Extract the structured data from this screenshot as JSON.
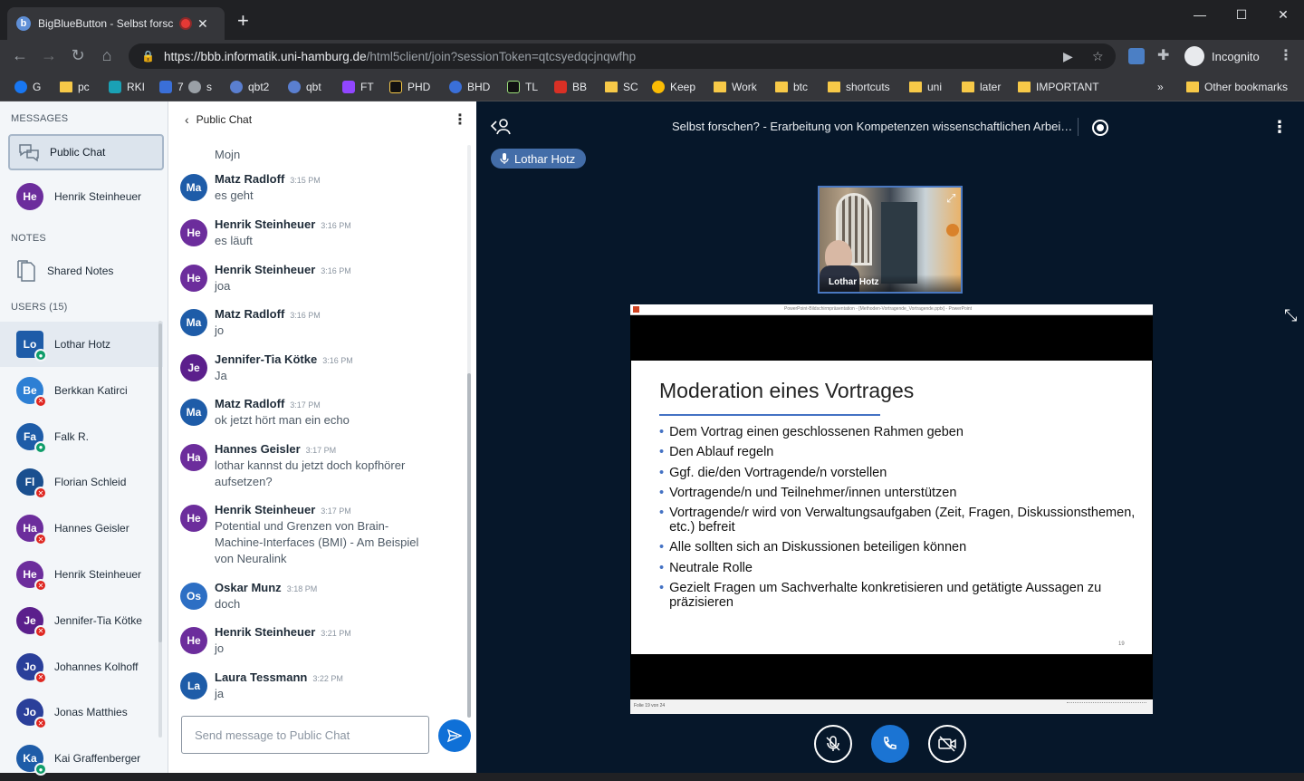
{
  "browser": {
    "tab_title": "BigBlueButton - Selbst forschen? - Erarbeitung von Kompetenzen",
    "tab_favicon": "b",
    "url_host": "https://bbb.informatik.uni-hamburg.de",
    "url_path": "/html5client/join?sessionToken=qtcsyedqcjnqwfhp",
    "profile_label": "Incognito",
    "bookmarks": [
      "G",
      "pc",
      "RKI",
      "7",
      "s",
      "qbt2",
      "qbt",
      "FT",
      "PHD",
      "BHD",
      "TL",
      "BB",
      "SC",
      "Keep",
      "Work",
      "btc",
      "shortcuts",
      "uni",
      "later",
      "IMPORTANT"
    ],
    "other_bookmarks": "Other bookmarks",
    "overflow": "»"
  },
  "sidebar": {
    "messages_title": "MESSAGES",
    "public_chat_label": "Public Chat",
    "private_chat_user": {
      "initials": "He",
      "name": "Henrik Steinheuer",
      "color": "#6c2d9c"
    },
    "notes_title": "NOTES",
    "shared_notes_label": "Shared Notes",
    "users_title": "USERS (15)",
    "users": [
      {
        "initials": "Lo",
        "name": "Lothar Hotz",
        "color": "#1e5ca8",
        "mic": "on",
        "presenter": true
      },
      {
        "initials": "Be",
        "name": "Berkkan Katirci",
        "color": "#2d7fd4",
        "mic": "muted"
      },
      {
        "initials": "Fa",
        "name": "Falk R.",
        "color": "#1e5ca8",
        "mic": "on"
      },
      {
        "initials": "Fl",
        "name": "Florian Schleid",
        "color": "#1a4f8f",
        "mic": "muted"
      },
      {
        "initials": "Ha",
        "name": "Hannes Geisler",
        "color": "#6c2d9c",
        "mic": "muted"
      },
      {
        "initials": "He",
        "name": "Henrik Steinheuer",
        "color": "#6c2d9c",
        "mic": "muted"
      },
      {
        "initials": "Je",
        "name": "Jennifer-Tia Kötke",
        "color": "#5b1f8c",
        "mic": "muted"
      },
      {
        "initials": "Jo",
        "name": "Johannes Kolhoff",
        "color": "#2a3f9a",
        "mic": "muted"
      },
      {
        "initials": "Jo",
        "name": "Jonas Matthies",
        "color": "#2a3f9a",
        "mic": "muted"
      },
      {
        "initials": "Ka",
        "name": "Kai Graffenberger",
        "color": "#1e5ca8",
        "mic": "on"
      }
    ]
  },
  "chat": {
    "title": "Public Chat",
    "partial_message": "Mojn",
    "messages": [
      {
        "initials": "Ma",
        "color": "#1e5ca8",
        "name": "Matz Radloff",
        "time": "3:15 PM",
        "text": "es geht"
      },
      {
        "initials": "He",
        "color": "#6c2d9c",
        "name": "Henrik Steinheuer",
        "time": "3:16 PM",
        "text": "es läuft"
      },
      {
        "initials": "He",
        "color": "#6c2d9c",
        "name": "Henrik Steinheuer",
        "time": "3:16 PM",
        "text": "joa"
      },
      {
        "initials": "Ma",
        "color": "#1e5ca8",
        "name": "Matz Radloff",
        "time": "3:16 PM",
        "text": "jo"
      },
      {
        "initials": "Je",
        "color": "#5b1f8c",
        "name": "Jennifer-Tia Kötke",
        "time": "3:16 PM",
        "text": "Ja"
      },
      {
        "initials": "Ma",
        "color": "#1e5ca8",
        "name": "Matz Radloff",
        "time": "3:17 PM",
        "text": "ok jetzt hört man ein echo"
      },
      {
        "initials": "Ha",
        "color": "#6c2d9c",
        "name": "Hannes Geisler",
        "time": "3:17 PM",
        "text": "lothar kannst du jetzt doch kopfhörer aufsetzen?"
      },
      {
        "initials": "He",
        "color": "#6c2d9c",
        "name": "Henrik Steinheuer",
        "time": "3:17 PM",
        "text": "Potential und Grenzen von Brain-Machine-Interfaces (BMI) - Am Beispiel von Neuralink"
      },
      {
        "initials": "Os",
        "color": "#2d6fc4",
        "name": "Oskar Munz",
        "time": "3:18 PM",
        "text": "doch"
      },
      {
        "initials": "He",
        "color": "#6c2d9c",
        "name": "Henrik Steinheuer",
        "time": "3:21 PM",
        "text": "jo"
      },
      {
        "initials": "La",
        "color": "#1e5ca8",
        "name": "Laura Tessmann",
        "time": "3:22 PM",
        "text": "ja"
      }
    ],
    "input_placeholder": "Send message to Public Chat"
  },
  "main": {
    "meeting_title": "Selbst forschen? - Erarbeitung von Kompetenzen wissenschaftlichen Arbei…",
    "talking_user": "Lothar Hotz",
    "webcam_user": "Lothar Hotz",
    "slide": {
      "title": "Moderation eines Vortrages",
      "bullets": [
        "Dem Vortrag einen geschlossenen Rahmen geben",
        "Den Ablauf regeln",
        "Ggf. die/den Vortragende/n vorstellen",
        "Vortragende/n und Teilnehmer/innen unterstützen",
        "Vortragende/r wird von Verwaltungsaufgaben (Zeit, Fragen, Diskussionsthemen, etc.) befreit",
        "Alle sollten sich an Diskussionen beteiligen können",
        "Neutrale Rolle",
        "Gezielt Fragen um Sachverhalte konkretisieren und getätigte Aussagen zu präzisieren"
      ],
      "page_number": "19",
      "ppt_titlebar": "PowerPoint-Bildschirmpräsentation - [Methoden-Vortragende_Vortragende.pptx] - PowerPoint",
      "ppt_status": "Folie 19 von 24"
    }
  }
}
